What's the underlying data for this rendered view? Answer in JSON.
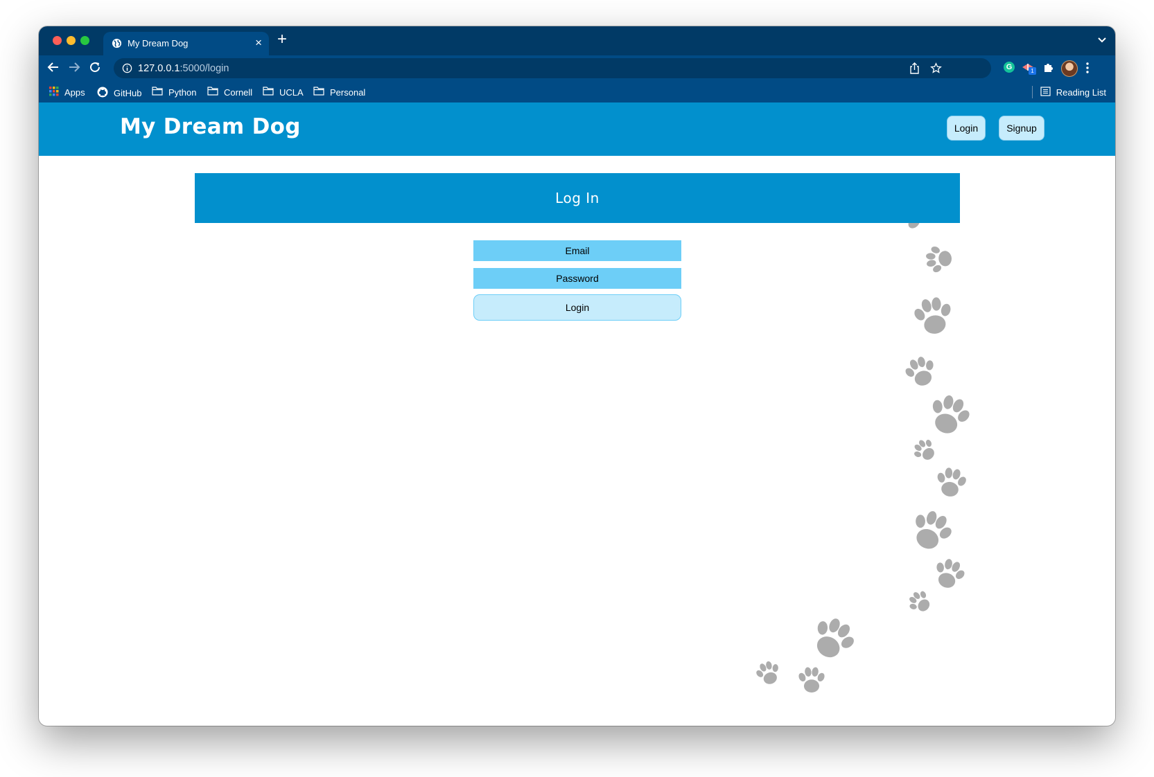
{
  "browser": {
    "tab_title": "My Dream Dog",
    "url_host": "127.0.0.1",
    "url_rest": ":5000/login",
    "extension_badge": "1",
    "grammarly_letter": "G"
  },
  "bookmarks": [
    {
      "label": "Apps",
      "icon": "apps-grid-icon"
    },
    {
      "label": "GitHub",
      "icon": "github-icon"
    },
    {
      "label": "Python",
      "icon": "folder-icon"
    },
    {
      "label": "Cornell",
      "icon": "folder-icon"
    },
    {
      "label": "UCLA",
      "icon": "folder-icon"
    },
    {
      "label": "Personal",
      "icon": "folder-icon"
    }
  ],
  "reading_list_label": "Reading List",
  "header": {
    "title": "My Dream Dog",
    "login_label": "Login",
    "signup_label": "Signup"
  },
  "login_form": {
    "heading": "Log In",
    "email_placeholder": "Email",
    "password_placeholder": "Password",
    "submit_label": "Login"
  },
  "colors": {
    "header_blue": "#0290cd",
    "field_blue": "#6dcef7",
    "button_light_blue": "#c6ecfc",
    "chrome_dark": "#013a66",
    "chrome_toolbar": "#014b85",
    "paw_gray": "#acacac"
  }
}
